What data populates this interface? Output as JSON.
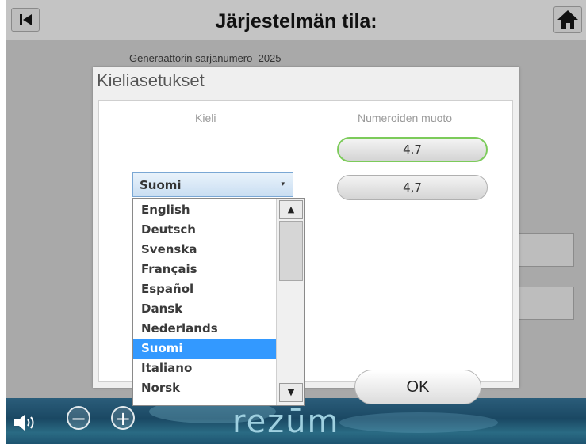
{
  "header": {
    "title": "Järjestelmän tila:"
  },
  "background": {
    "serial_label": "Generaattorin sarjanumero",
    "serial_value": "2025"
  },
  "dialog": {
    "title": "Kieliasetukset",
    "language_label": "Kieli",
    "number_format_label": "Numeroiden muoto",
    "selected_language": "Suomi",
    "languages": [
      "English",
      "Deutsch",
      "Svenska",
      "Français",
      "Español",
      "Dansk",
      "Nederlands",
      "Suomi",
      "Italiano",
      "Norsk"
    ],
    "highlighted_index": 7,
    "number_formats": [
      "4.7",
      "4,7"
    ],
    "selected_number_format_index": 0,
    "ok_label": "OK"
  },
  "footer": {
    "logo_text": "rezūm",
    "volume_down": "−",
    "volume_up": "+"
  },
  "colors": {
    "selection_blue": "#3399ff",
    "active_outline_green": "#7ccb5a"
  }
}
